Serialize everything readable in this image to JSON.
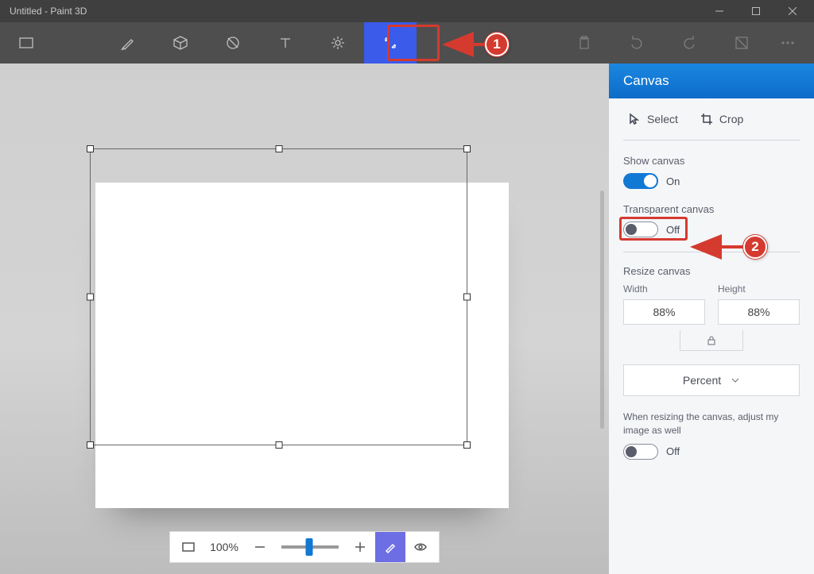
{
  "window": {
    "title": "Untitled - Paint 3D"
  },
  "toolbar": {
    "items": [
      "menu",
      "brushes",
      "shapes-3d",
      "shapes-2d",
      "text",
      "effects",
      "canvas"
    ],
    "active_index": 6,
    "right_items": [
      "paste",
      "undo",
      "redo",
      "view-3d",
      "more"
    ]
  },
  "zoom": {
    "level": "100%"
  },
  "panel": {
    "header": "Canvas",
    "tools": {
      "select": "Select",
      "crop": "Crop"
    },
    "show_canvas": {
      "label": "Show canvas",
      "state": "On"
    },
    "transparent_canvas": {
      "label": "Transparent canvas",
      "state": "Off"
    },
    "resize": {
      "label": "Resize canvas",
      "width_label": "Width",
      "height_label": "Height",
      "width_value": "88%",
      "height_value": "88%",
      "unit": "Percent"
    },
    "resize_note": "When resizing the canvas, adjust my image as well",
    "resize_adjust_state": "Off"
  },
  "annotations": {
    "badge1": "1",
    "badge2": "2"
  }
}
